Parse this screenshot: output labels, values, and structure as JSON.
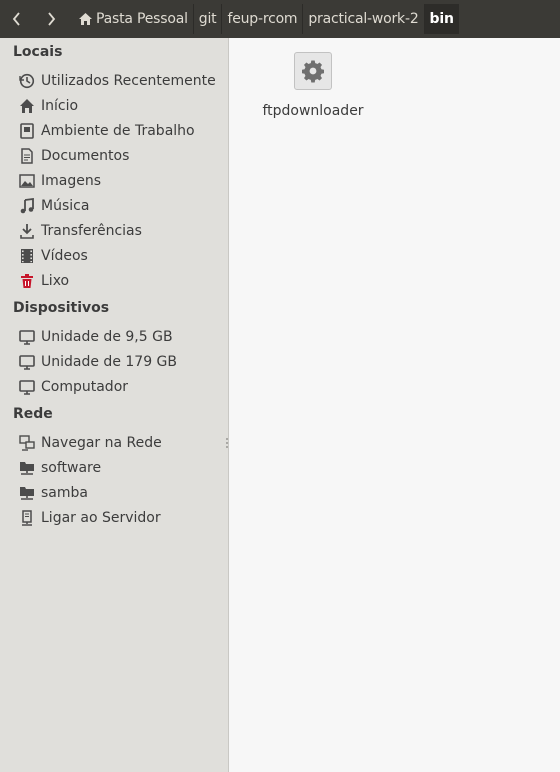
{
  "toolbar": {
    "back_icon": "chevron-left-icon",
    "forward_icon": "chevron-right-icon",
    "breadcrumbs": [
      "Pasta Pessoal",
      "git",
      "feup-rcom",
      "practical-work-2",
      "bin"
    ]
  },
  "sidebar": {
    "sections": [
      {
        "title": "Locais",
        "items": [
          {
            "label": "Utilizados Recentemente",
            "icon": "recent-icon"
          },
          {
            "label": "Início",
            "icon": "home-icon"
          },
          {
            "label": "Ambiente de Trabalho",
            "icon": "desktop-icon"
          },
          {
            "label": "Documentos",
            "icon": "document-icon"
          },
          {
            "label": "Imagens",
            "icon": "image-icon"
          },
          {
            "label": "Música",
            "icon": "music-icon"
          },
          {
            "label": "Transferências",
            "icon": "download-icon"
          },
          {
            "label": "Vídeos",
            "icon": "video-icon"
          },
          {
            "label": "Lixo",
            "icon": "trash-icon"
          }
        ]
      },
      {
        "title": "Dispositivos",
        "items": [
          {
            "label": "Unidade de 9,5 GB",
            "icon": "drive-icon"
          },
          {
            "label": "Unidade de 179 GB",
            "icon": "drive-icon"
          },
          {
            "label": "Computador",
            "icon": "computer-icon"
          }
        ]
      },
      {
        "title": "Rede",
        "items": [
          {
            "label": "Navegar na Rede",
            "icon": "network-icon"
          },
          {
            "label": "software",
            "icon": "network-folder-icon"
          },
          {
            "label": "samba",
            "icon": "network-folder-icon"
          },
          {
            "label": "Ligar ao Servidor",
            "icon": "server-icon"
          }
        ]
      }
    ]
  },
  "main": {
    "files": [
      {
        "name": "ftpdownloader",
        "icon": "gear-icon"
      }
    ]
  },
  "colors": {
    "toolbar_bg": "#3b3a36",
    "sidebar_bg": "#e0dfdb",
    "content_bg": "#f7f7f7",
    "trash_red": "#c7162b"
  }
}
